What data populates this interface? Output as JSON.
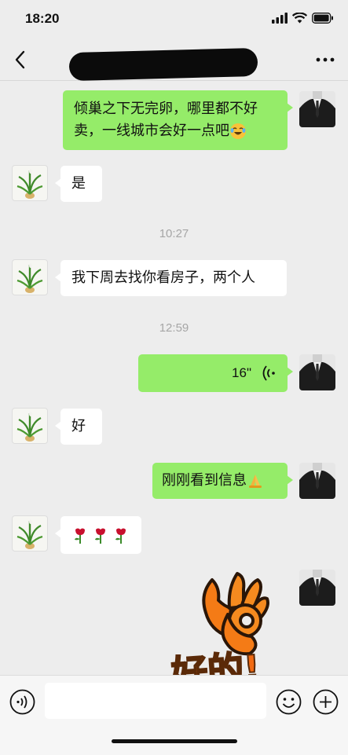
{
  "status_bar": {
    "time": "18:20"
  },
  "nav": {
    "title_redacted": true
  },
  "messages": [
    {
      "direction": "out",
      "text": "倾巢之下无完卵，哪里都不好卖，一线城市会好一点吧",
      "emoji": "laugh-cry"
    },
    {
      "direction": "in",
      "text": "是"
    },
    {
      "timestamp": "10:27"
    },
    {
      "direction": "in",
      "text": "我下周去找你看房子，两个人"
    },
    {
      "timestamp": "12:59"
    },
    {
      "direction": "out",
      "voice_duration": "16\""
    },
    {
      "direction": "in",
      "text": "好"
    },
    {
      "direction": "out",
      "text": "刚刚看到信息",
      "emoji": "folded-hands"
    },
    {
      "direction": "in",
      "emojis": [
        "rose",
        "rose",
        "rose"
      ]
    },
    {
      "direction": "out",
      "sticker": "ok-hand",
      "sticker_text": "好的!"
    }
  ],
  "input": {
    "placeholder": ""
  },
  "colors": {
    "outgoing_bubble": "#95ec69",
    "incoming_bubble": "#ffffff",
    "background": "#ededed"
  }
}
